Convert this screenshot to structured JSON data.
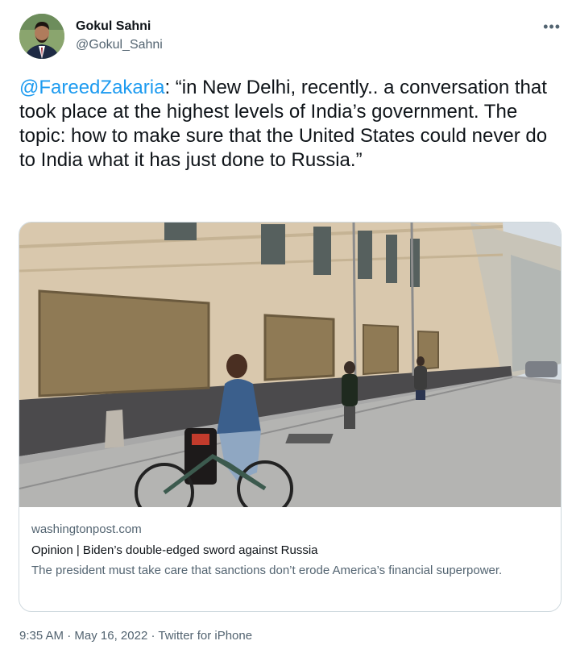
{
  "tweet": {
    "author": {
      "name": "Gokul Sahni",
      "handle": "@Gokul_Sahni"
    },
    "more_icon": "more-horizontal-icon",
    "mention": "@FareedZakaria",
    "text": ": “in New Delhi, recently..  a conversation that took place at the highest levels of India’s government. The topic: how to make sure that the United States could never do to India what it has just done to Russia.”",
    "link_card": {
      "domain": "washingtonpost.com",
      "title": "Opinion | Biden’s double-edged sword against Russia",
      "description": "The president must take care that sanctions don’t erode America’s financial superpower."
    },
    "meta": {
      "time": "9:35 AM",
      "date": "May 16, 2022",
      "source": "Twitter for iPhone",
      "separator": " · "
    }
  },
  "colors": {
    "link": "#1d9bf0",
    "secondary_text": "#536471",
    "border": "#cfd9de"
  }
}
